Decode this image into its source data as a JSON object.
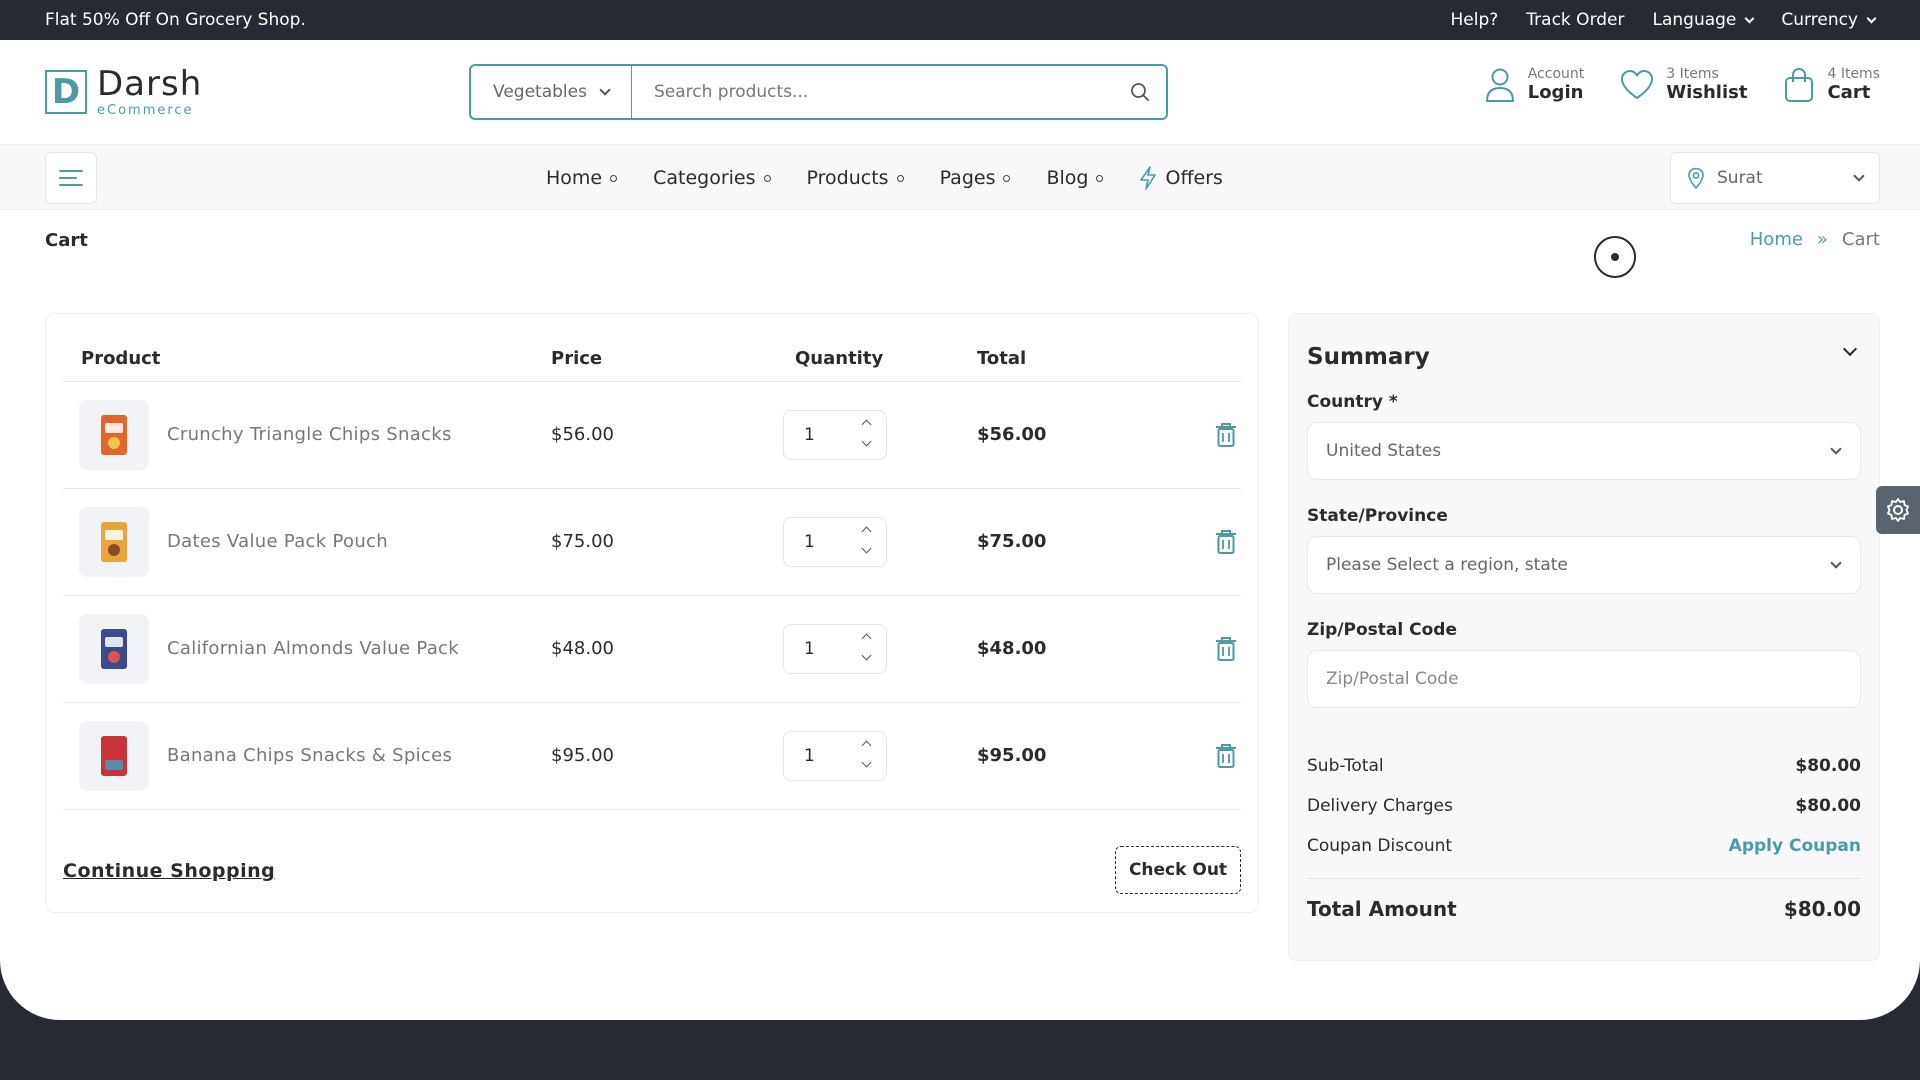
{
  "topbar": {
    "promo": "Flat 50% Off On Grocery Shop.",
    "help": "Help?",
    "track_order": "Track Order",
    "language": "Language",
    "currency": "Currency"
  },
  "brand": {
    "name": "Darsh",
    "tagline": "eCommerce",
    "mark": "D",
    "accent": "#4b9aa6"
  },
  "search": {
    "category": "Vegetables",
    "placeholder": "Search products..."
  },
  "header": {
    "account": {
      "small": "Account",
      "big": "Login"
    },
    "wishlist": {
      "small": "3 Items",
      "big": "Wishlist"
    },
    "cart": {
      "small": "4 Items",
      "big": "Cart"
    }
  },
  "nav": {
    "items": [
      "Home",
      "Categories",
      "Products",
      "Pages",
      "Blog"
    ],
    "offers": "Offers",
    "location": "Surat"
  },
  "breadcrumb": {
    "title": "Cart",
    "home": "Home",
    "sep": "»",
    "current": "Cart"
  },
  "cart": {
    "headers": {
      "product": "Product",
      "price": "Price",
      "quantity": "Quantity",
      "total": "Total"
    },
    "items": [
      {
        "name": "Crunchy Triangle Chips Snacks",
        "price": "$56.00",
        "qty": "1",
        "total": "$56.00",
        "pack_color": "#e0662a"
      },
      {
        "name": "Dates Value Pack Pouch",
        "price": "$75.00",
        "qty": "1",
        "total": "$75.00",
        "pack_color": "#e8a63a"
      },
      {
        "name": "Californian Almonds Value Pack",
        "price": "$48.00",
        "qty": "1",
        "total": "$48.00",
        "pack_color": "#3a4a8a"
      },
      {
        "name": "Banana Chips Snacks & Spices",
        "price": "$95.00",
        "qty": "1",
        "total": "$95.00",
        "pack_color": "#c8323a"
      }
    ],
    "continue": "Continue Shopping",
    "checkout": "Check Out"
  },
  "summary": {
    "title": "Summary",
    "country_label": "Country *",
    "country_value": "United States",
    "state_label": "State/Province",
    "state_value": "Please Select a region, state",
    "zip_label": "Zip/Postal Code",
    "zip_placeholder": "Zip/Postal Code",
    "subtotal_label": "Sub-Total",
    "subtotal": "$80.00",
    "delivery_label": "Delivery Charges",
    "delivery": "$80.00",
    "coupon_label": "Coupan Discount",
    "coupon_action": "Apply Coupan",
    "total_label": "Total Amount",
    "total": "$80.00"
  }
}
